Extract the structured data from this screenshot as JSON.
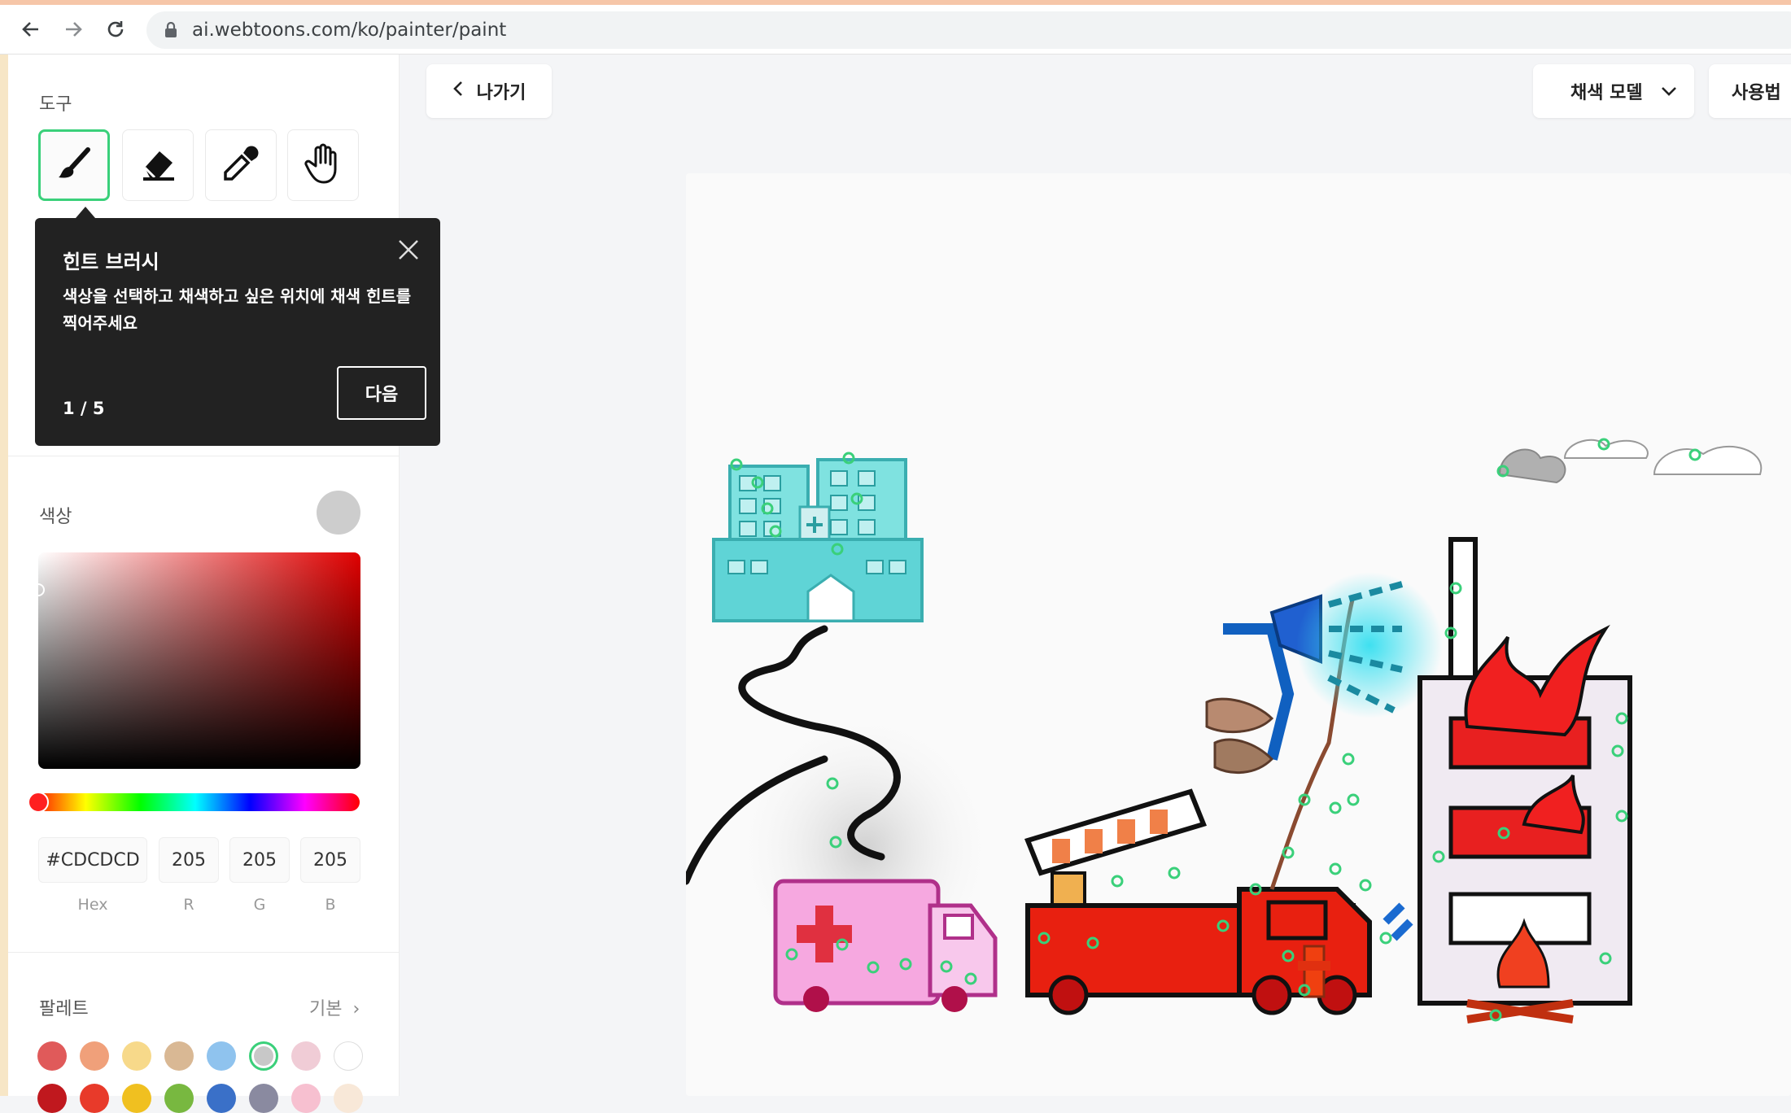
{
  "browser": {
    "url": "ai.webtoons.com/ko/painter/paint"
  },
  "sidebar": {
    "tools_label": "도구",
    "tools": [
      {
        "name": "brush",
        "icon": "brush-icon",
        "active": true
      },
      {
        "name": "eraser",
        "icon": "eraser-icon",
        "active": false
      },
      {
        "name": "eyedropper",
        "icon": "eyedropper-icon",
        "active": false
      },
      {
        "name": "hand",
        "icon": "hand-icon",
        "active": false
      }
    ],
    "tooltip": {
      "title": "힌트 브러시",
      "body": "색상을 선택하고 채색하고 싶은 위치에 채색 힌트를 찍어주세요",
      "page": "1 / 5",
      "next_label": "다음"
    },
    "color": {
      "label": "색상",
      "current": "#CDCDCD",
      "hex_value": "#CDCDCD",
      "r": "205",
      "g": "205",
      "b": "205",
      "hex_label": "Hex",
      "r_label": "R",
      "g_label": "G",
      "b_label": "B",
      "hue": "#ff0000"
    },
    "palette": {
      "label": "팔레트",
      "preset_label": "기본",
      "row1": [
        "#e05a5a",
        "#f0a07a",
        "#f7d98a",
        "#d9b894",
        "#8fc3ee",
        "#c8c8c8",
        "#f0ccd6",
        "#ffffff"
      ],
      "row2": [
        "#c0181e",
        "#e83a2a",
        "#f0c020",
        "#78b840",
        "#3a70c8",
        "#8a8aa0",
        "#f7c0d0",
        "#f8e8d8"
      ],
      "selected_index": 5
    }
  },
  "toolbar": {
    "back_label": "나가기",
    "model_label": "채색 모델",
    "help_label": "사용법"
  },
  "colors": {
    "accent": "#3ad07a",
    "hint_dot": "#3ad07a"
  }
}
